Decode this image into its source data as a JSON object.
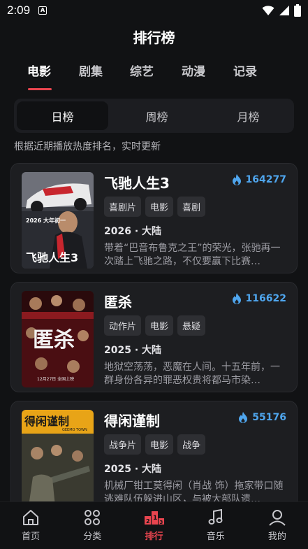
{
  "status": {
    "time": "2:09",
    "badge": "A"
  },
  "title": "排行榜",
  "categories": [
    {
      "label": "电影",
      "active": true
    },
    {
      "label": "剧集",
      "active": false
    },
    {
      "label": "综艺",
      "active": false
    },
    {
      "label": "动漫",
      "active": false
    },
    {
      "label": "记录",
      "active": false
    }
  ],
  "periods": [
    {
      "label": "日榜",
      "active": true
    },
    {
      "label": "周榜",
      "active": false
    },
    {
      "label": "月榜",
      "active": false
    }
  ],
  "hint": "根据近期播放热度排名，实时更新",
  "movies": [
    {
      "title": "飞驰人生3",
      "heat": "164277",
      "tags": [
        "喜剧片",
        "电影",
        "喜剧"
      ],
      "meta": "2026 · 大陆",
      "desc": "带着“巴音布鲁克之王”的荣光，张驰再一次踏上飞驰之路，不仅要赢下比赛…",
      "poster_text": "飞驰人生3",
      "poster_small": "2026 大年初一"
    },
    {
      "title": "匿杀",
      "heat": "116622",
      "tags": [
        "动作片",
        "电影",
        "悬疑"
      ],
      "meta": "2025 · 大陆",
      "desc": "地狱空荡荡，恶魔在人间。十五年前，一群身份各异的罪恶权贵将都马市染…",
      "poster_text": "匿杀",
      "poster_small": "12月27日 全国上映"
    },
    {
      "title": "得闲谨制",
      "heat": "55176",
      "tags": [
        "战争片",
        "电影",
        "战争"
      ],
      "meta": "2025 · 大陆",
      "desc": "机械厂钳工莫得闲（肖战 饰）拖家带口随逃难队伍躲进山区，与被大部队遗…",
      "poster_text": "得闲谨制",
      "poster_small": "GEEMO TOWN"
    }
  ],
  "nav": [
    {
      "label": "首页",
      "icon": "home-icon",
      "active": false
    },
    {
      "label": "分类",
      "icon": "category-icon",
      "active": false
    },
    {
      "label": "排行",
      "icon": "ranking-icon",
      "active": true
    },
    {
      "label": "音乐",
      "icon": "music-icon",
      "active": false
    },
    {
      "label": "我的",
      "icon": "profile-icon",
      "active": false
    }
  ],
  "colors": {
    "accent": "#e8454f",
    "heat": "#4fa6ee",
    "background": "#111214",
    "card": "#1d1e21"
  }
}
